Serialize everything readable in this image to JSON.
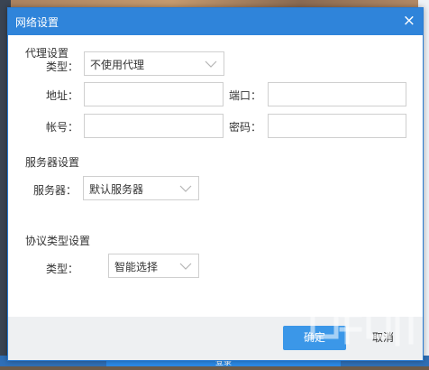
{
  "dialog": {
    "title": "网络设置",
    "close_label": "×"
  },
  "proxy": {
    "section_title": "代理设置",
    "type_label": "类型：",
    "type_value": "不使用代理",
    "address_label": "地址：",
    "address_value": "",
    "port_label": "端口：",
    "port_value": "",
    "account_label": "帐号：",
    "account_value": "",
    "password_label": "密码：",
    "password_value": ""
  },
  "server": {
    "section_title": "服务器设置",
    "server_label": "服务器：",
    "server_value": "默认服务器"
  },
  "protocol": {
    "section_title": "协议类型设置",
    "type_label": "类型：",
    "type_value": "智能选择"
  },
  "footer": {
    "ok_label": "确定",
    "cancel_label": "取消"
  },
  "background": {
    "bottom_button_label": "登录"
  },
  "colors": {
    "titlebar": "#2f84da",
    "primary_button": "#3b97e8",
    "footer_bg": "#eef0f2"
  }
}
